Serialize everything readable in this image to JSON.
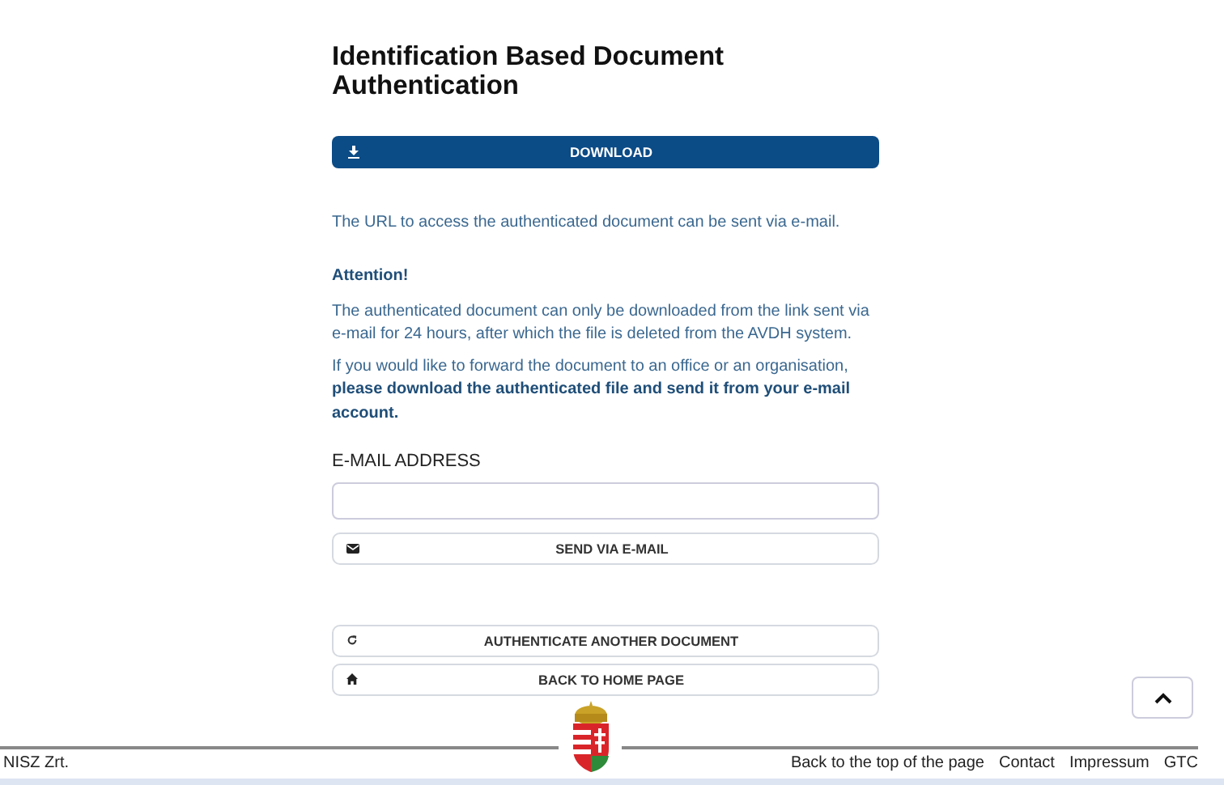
{
  "title": "Identification Based Document Authentication",
  "download_button": {
    "label": "DOWNLOAD"
  },
  "info_text": "The URL to access the authenticated document can be sent via e-mail.",
  "attention": {
    "heading": "Attention!",
    "paragraphs": [
      "The authenticated document can only be downloaded from the link sent via e-mail for 24 hours, after which the file is deleted from the AVDH system.",
      "If you would like to forward the document to an office or an organisation, **please download the authenticated file and send it from your e-mail account.**"
    ]
  },
  "email_field": {
    "label": "E-MAIL ADDRESS"
  },
  "send_button": {
    "label": "SEND VIA E-MAIL"
  },
  "actions": [
    {
      "kind": "refresh",
      "label": "AUTHENTICATE ANOTHER DOCUMENT"
    },
    {
      "kind": "home",
      "label": "BACK TO HOME PAGE"
    }
  ],
  "footer": {
    "copyright": "NISZ Zrt.",
    "links": [
      "Back to the top of the page",
      "Contact",
      "Impressum",
      "GTC"
    ]
  }
}
